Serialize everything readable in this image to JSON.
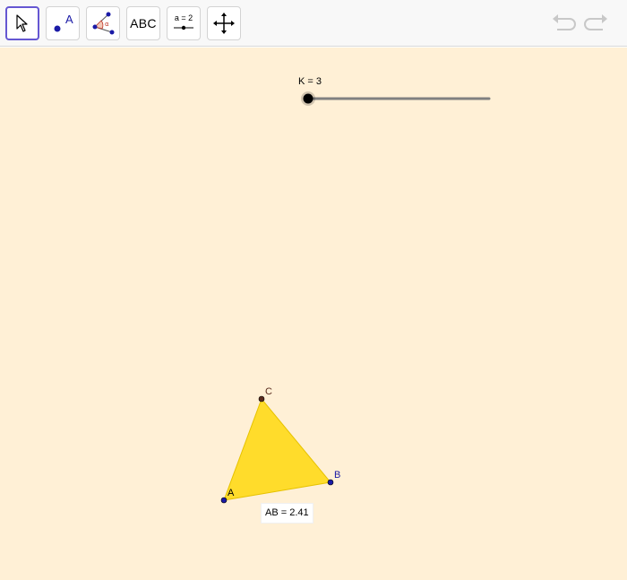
{
  "toolbar": {
    "tools": [
      {
        "name": "Move",
        "icon": "cursor-arrow-icon",
        "selected": true
      },
      {
        "name": "Point",
        "icon": "point-icon",
        "label": "A"
      },
      {
        "name": "Angle",
        "icon": "angle-icon",
        "label": "α"
      },
      {
        "name": "Text",
        "icon": "text-icon",
        "label": "ABC"
      },
      {
        "name": "Slider",
        "icon": "slider-icon",
        "label": "a = 2"
      },
      {
        "name": "Move Graphics View",
        "icon": "move-view-icon"
      }
    ],
    "undo_icon": "undo-icon",
    "redo_icon": "redo-icon"
  },
  "canvas": {
    "background": "#fff0d6",
    "slider": {
      "label": "K = 3",
      "value": 3,
      "min": 3,
      "max": 10
    },
    "points": {
      "A": {
        "label": "A",
        "color": "#1a1aa6"
      },
      "B": {
        "label": "B",
        "color": "#1a1aa6"
      },
      "C": {
        "label": "C",
        "color": "#5a2b1e"
      }
    },
    "polygon": {
      "fill": "#ffd700",
      "stroke": "#e6c200"
    },
    "measurement": "AB = 2.41"
  },
  "colors": {
    "accent": "#6557d2",
    "slider_track": "#808080",
    "slider_knob": "#000000"
  }
}
